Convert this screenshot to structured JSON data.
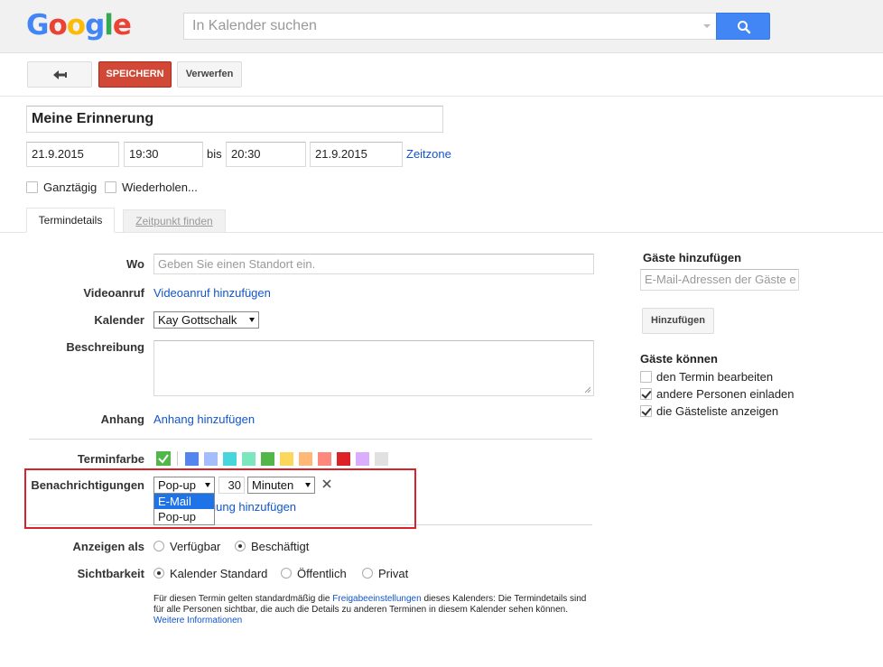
{
  "header": {
    "logo_letters": [
      {
        "ch": "G",
        "color": "#4285f4"
      },
      {
        "ch": "o",
        "color": "#ea4335"
      },
      {
        "ch": "o",
        "color": "#fbbc05"
      },
      {
        "ch": "g",
        "color": "#4285f4"
      },
      {
        "ch": "l",
        "color": "#34a853"
      },
      {
        "ch": "e",
        "color": "#ea4335"
      }
    ],
    "search_placeholder": "In Kalender suchen",
    "search_icon": "search-icon"
  },
  "toolbar": {
    "back_icon": "back-arrow-icon",
    "save_label": "SPEICHERN",
    "discard_label": "Verwerfen"
  },
  "event": {
    "title": "Meine Erinnerung",
    "start_date": "21.9.2015",
    "start_time": "19:30",
    "until_label": "bis",
    "end_time": "20:30",
    "end_date": "21.9.2015",
    "timezone_link": "Zeitzone",
    "all_day_label": "Ganztägig",
    "repeat_label": "Wiederholen..."
  },
  "tabs": {
    "details": "Termindetails",
    "find_time": "Zeitpunkt finden"
  },
  "form": {
    "where_label": "Wo",
    "where_placeholder": "Geben Sie einen Standort ein.",
    "video_label": "Videoanruf",
    "video_link": "Videoanruf hinzufügen",
    "calendar_label": "Kalender",
    "calendar_value": "Kay Gottschalk",
    "description_label": "Beschreibung",
    "attachment_label": "Anhang",
    "attachment_link": "Anhang hinzufügen",
    "color_label": "Terminfarbe",
    "colors": [
      "#5484ed",
      "#a4bdfc",
      "#46d6db",
      "#7ae7bf",
      "#51b749",
      "#fbd75b",
      "#ffb878",
      "#ff887c",
      "#dc2127",
      "#dbadff",
      "#e1e1e1"
    ],
    "default_color": "#51b749",
    "notifications_label": "Benachrichtigungen",
    "notification_type": "Pop-up",
    "notification_amount": "30",
    "notification_unit": "Minuten",
    "notification_options": [
      "E-Mail",
      "Pop-up"
    ],
    "add_notification_link_visible": "igung hinzufügen",
    "show_as_label": "Anzeigen als",
    "available_label": "Verfügbar",
    "busy_label": "Beschäftigt",
    "visibility_label": "Sichtbarkeit",
    "vis_default": "Kalender Standard",
    "vis_public": "Öffentlich",
    "vis_private": "Privat",
    "help_text_1": "Für diesen Termin gelten standardmäßig die ",
    "help_link_1": "Freigabeeinstellungen",
    "help_text_2": " dieses Kalenders: Die Termindetails sind für alle Personen sichtbar, die auch die Details zu anderen Terminen in diesem Kalender sehen können. ",
    "help_link_2": "Weitere Informationen"
  },
  "guests": {
    "title": "Gäste hinzufügen",
    "placeholder": "E-Mail-Adressen der Gäste e",
    "add_button": "Hinzufügen",
    "can_title": "Gäste können",
    "perms": [
      {
        "label": "den Termin bearbeiten",
        "checked": false
      },
      {
        "label": "andere Personen einladen",
        "checked": true
      },
      {
        "label": "die Gästeliste anzeigen",
        "checked": true
      }
    ]
  }
}
